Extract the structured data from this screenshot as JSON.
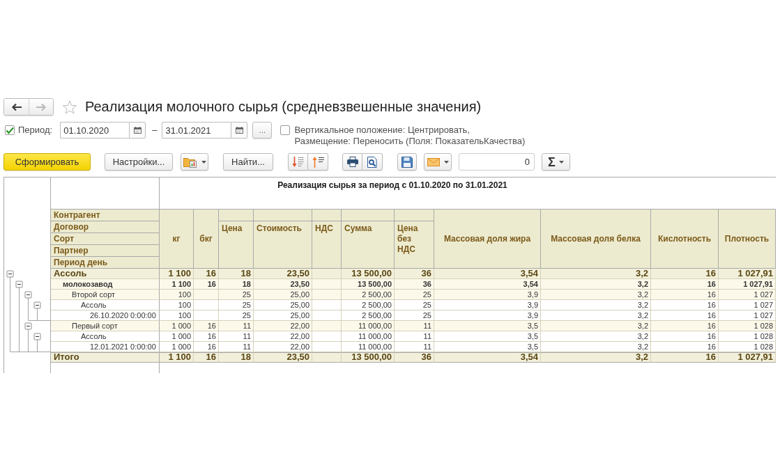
{
  "nav_buttons": [
    {
      "kind": "back",
      "disabled": false
    },
    {
      "kind": "forward",
      "disabled": true
    }
  ],
  "starred": false,
  "title": "Реализация молочного сырья (средневзвешенные значения)",
  "period": {
    "checked": true,
    "label": "Период:",
    "from": "01.10.2020",
    "separator": "–",
    "to": "31.01.2021",
    "choose_button": "..."
  },
  "layout_option": {
    "checked": false,
    "label_lines": [
      "Вертикальное положение: Центрировать,",
      "Размещение: Переносить (Поля: ПоказательКачества)"
    ]
  },
  "command_bar": {
    "generate_button": "Сформировать",
    "settings_button": "Настройки...",
    "find_button": "Найти...",
    "counter_field": "0",
    "sum_button": "Σ"
  },
  "report": {
    "title": "Реализация сырья за период с 01.10.2020 по 31.01.2021",
    "grouping_headers": [
      "Контрагент",
      "Договор",
      "Сорт",
      "Партнер",
      "Период день"
    ],
    "columns": [
      {
        "label": "кг",
        "kind": "full"
      },
      {
        "label": "бкг",
        "kind": "full"
      },
      {
        "label": "Цена",
        "kind": "split"
      },
      {
        "label": "Стоимость",
        "kind": "split"
      },
      {
        "label": "НДС",
        "kind": "split"
      },
      {
        "label": "Сумма",
        "kind": "split"
      },
      {
        "label": "Цена без НДС",
        "kind": "split"
      },
      {
        "label": "Массовая доля жира",
        "kind": "full"
      },
      {
        "label": "Массовая доля белка",
        "kind": "full"
      },
      {
        "label": "Кислотность",
        "kind": "full"
      },
      {
        "label": "Плотность",
        "kind": "full"
      }
    ],
    "rows": [
      {
        "label": "Ассоль",
        "expanded": true,
        "values": {
          "kg": "1 100",
          "bkg": "16",
          "price": "18",
          "cost": "23,50",
          "sum": "13 500,00",
          "price_no_vat": "36",
          "fat": "3,54",
          "protein": "3,2",
          "acidity": "16",
          "density": "1 027,91"
        },
        "children": [
          {
            "label": "молокозавод",
            "expanded": true,
            "values": {
              "kg": "1 100",
              "bkg": "16",
              "price": "18",
              "cost": "23,50",
              "sum": "13 500,00",
              "price_no_vat": "36",
              "fat": "3,54",
              "protein": "3,2",
              "acidity": "16",
              "density": "1 027,91"
            },
            "children": [
              {
                "label": "Второй сорт",
                "expanded": true,
                "values": {
                  "kg": "100",
                  "price": "25",
                  "cost": "25,00",
                  "sum": "2 500,00",
                  "price_no_vat": "25",
                  "fat": "3,9",
                  "protein": "3,2",
                  "acidity": "16",
                  "density": "1 027"
                },
                "children": [
                  {
                    "label": "Ассоль",
                    "expanded": true,
                    "values": {
                      "kg": "100",
                      "price": "25",
                      "cost": "25,00",
                      "sum": "2 500,00",
                      "price_no_vat": "25",
                      "fat": "3,9",
                      "protein": "3,2",
                      "acidity": "16",
                      "density": "1 027"
                    },
                    "children": [
                      {
                        "label": "26.10.2020 0:00:00",
                        "values": {
                          "kg": "100",
                          "price": "25",
                          "cost": "25,00",
                          "sum": "2 500,00",
                          "price_no_vat": "25",
                          "fat": "3,9",
                          "protein": "3,2",
                          "acidity": "16",
                          "density": "1 027"
                        }
                      }
                    ]
                  }
                ]
              },
              {
                "label": "Первый сорт",
                "expanded": true,
                "values": {
                  "kg": "1 000",
                  "bkg": "16",
                  "price": "11",
                  "cost": "22,00",
                  "sum": "11 000,00",
                  "price_no_vat": "11",
                  "fat": "3,5",
                  "protein": "3,2",
                  "acidity": "16",
                  "density": "1 028"
                },
                "children": [
                  {
                    "label": "Ассоль",
                    "expanded": true,
                    "values": {
                      "kg": "1 000",
                      "bkg": "16",
                      "price": "11",
                      "cost": "22,00",
                      "sum": "11 000,00",
                      "price_no_vat": "11",
                      "fat": "3,5",
                      "protein": "3,2",
                      "acidity": "16",
                      "density": "1 028"
                    },
                    "children": [
                      {
                        "label": "12.01.2021 0:00:00",
                        "values": {
                          "kg": "1 000",
                          "bkg": "16",
                          "price": "11",
                          "cost": "22,00",
                          "sum": "11 000,00",
                          "price_no_vat": "11",
                          "fat": "3,5",
                          "protein": "3,2",
                          "acidity": "16",
                          "density": "1 028"
                        }
                      }
                    ]
                  }
                ]
              }
            ]
          }
        ]
      }
    ],
    "total": {
      "label": "Итого",
      "values": {
        "kg": "1 100",
        "bkg": "16",
        "price": "18",
        "cost": "23,50",
        "sum": "13 500,00",
        "price_no_vat": "36",
        "fat": "3,54",
        "protein": "3,2",
        "acidity": "16",
        "density": "1 027,91"
      }
    }
  }
}
